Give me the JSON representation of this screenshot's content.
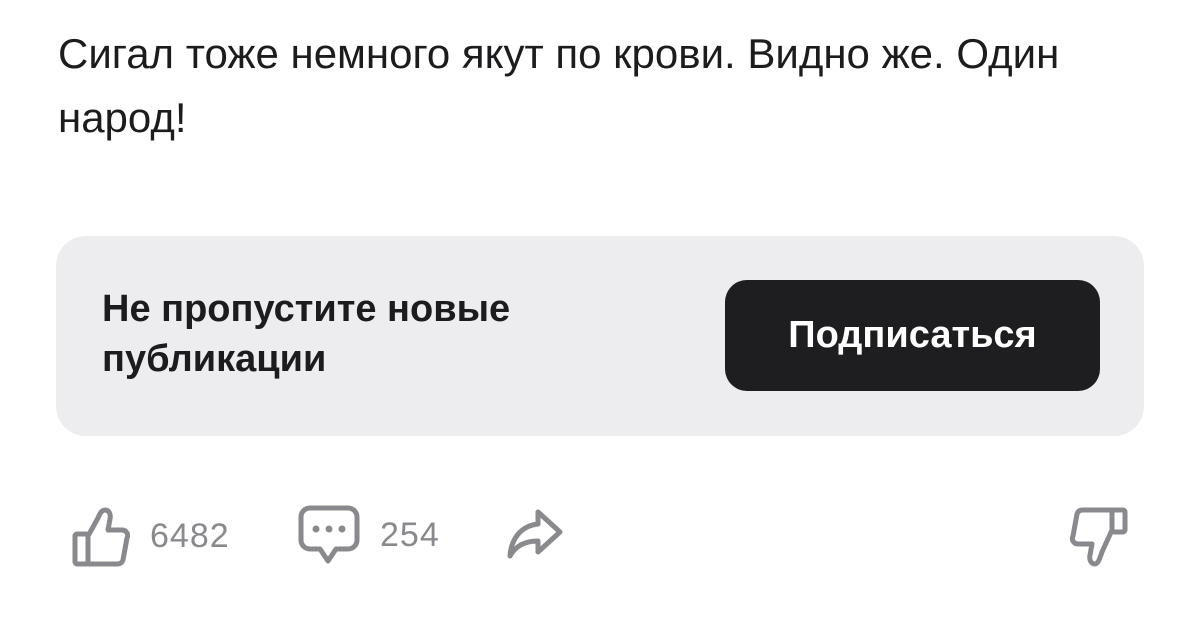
{
  "post": {
    "text": "Сигал тоже немного якут по крови. Видно же. Один народ!"
  },
  "subscribe": {
    "text": "Не пропустите новые публикации",
    "button_label": "Подписаться"
  },
  "actions": {
    "like_count": "6482",
    "comment_count": "254",
    "icons": [
      "thumbs-up-icon",
      "comment-bubble-icon",
      "share-arrow-icon",
      "thumbs-down-icon"
    ],
    "icon_color": "#8a8a8e"
  },
  "colors": {
    "card_background": "#ededef",
    "button_background": "#1e1e20",
    "button_text": "#ffffff",
    "text": "#1c1c1e"
  }
}
